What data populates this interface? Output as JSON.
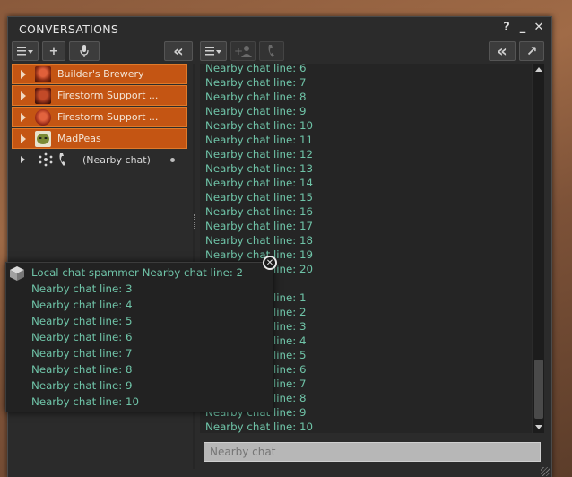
{
  "window": {
    "title": "CONVERSATIONS",
    "help_label": "?",
    "minimize_label": "_",
    "close_label": "✕"
  },
  "left_toolbar": {
    "menu_icon": "list-menu-icon",
    "add_label": "+",
    "mic_icon": "microphone-icon",
    "collapse_label": "«"
  },
  "right_toolbar": {
    "menu_icon": "list-menu-icon",
    "add_person_icon": "add-person-icon",
    "call_icon": "phone-icon",
    "collapse_label": "«",
    "popout_label": "↗"
  },
  "conversations": [
    {
      "label": "Builder's Brewery",
      "avatar_color": "#8a2b12"
    },
    {
      "label": "Firestorm Support ...",
      "avatar_color": "#6b1f10"
    },
    {
      "label": "Firestorm Support ...",
      "avatar_color": "#9b2a17"
    },
    {
      "label": "MadPeas",
      "avatar_color": "#d9d1b8"
    }
  ],
  "nearby": {
    "label": "(Nearby chat)"
  },
  "chat_history": [
    "Nearby chat line: 6",
    "Nearby chat line: 7",
    "Nearby chat line: 8",
    "Nearby chat line: 9",
    "Nearby chat line: 10",
    "Nearby chat line: 11",
    "Nearby chat line: 12",
    "Nearby chat line: 13",
    "Nearby chat line: 14",
    "Nearby chat line: 15",
    "Nearby chat line: 16",
    "Nearby chat line: 17",
    "Nearby chat line: 18",
    "Nearby chat line: 19",
    "Nearby chat line: 20",
    "",
    "Nearby chat line: 1",
    "Nearby chat line: 2",
    "Nearby chat line: 3",
    "Nearby chat line: 4",
    "Nearby chat line: 5",
    "Nearby chat line: 6",
    "Nearby chat line: 7",
    "Nearby chat line: 8",
    "Nearby chat line: 9",
    "Nearby chat line: 10"
  ],
  "chat_input": {
    "placeholder": "Nearby chat"
  },
  "toast": {
    "lines": [
      "Local chat spammer Nearby chat line: 2",
      "Nearby chat line: 3",
      "Nearby chat line: 4",
      "Nearby chat line: 5",
      "Nearby chat line: 6",
      "Nearby chat line: 7",
      "Nearby chat line: 8",
      "Nearby chat line: 9",
      "Nearby chat line: 10"
    ],
    "close_label": "✕"
  },
  "colors": {
    "accent": "#c45513",
    "chat_text": "#6fc4a8"
  }
}
